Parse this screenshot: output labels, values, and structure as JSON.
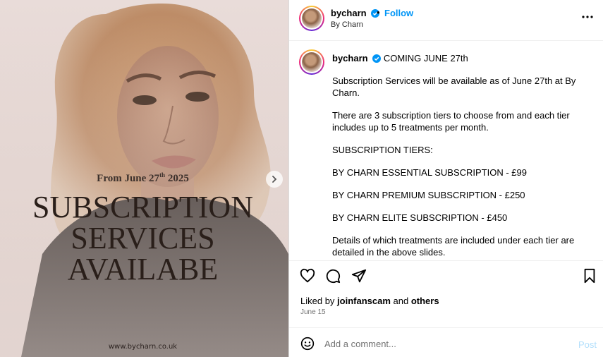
{
  "media": {
    "date_prefix": "From June 27",
    "date_sup": "th",
    "date_suffix": "2025",
    "headline": [
      "SUBSCRIPTION",
      "SERVICES",
      "AVAILABE"
    ],
    "website": "www.bycharn.co.uk"
  },
  "header": {
    "username": "bycharn",
    "separator": "•",
    "follow_label": "Follow",
    "subtitle": "By Charn",
    "more_icon": "more-horizontal-icon"
  },
  "caption": {
    "username": "bycharn",
    "headline": "COMING JUNE 27th",
    "paragraphs": [
      "Subscription Services will be available as of June 27th at By Charn.",
      "There are 3 subscription tiers to choose from and each tier includes up to 5 treatments per month.",
      "SUBSCRIPTION TIERS:",
      "BY CHARN ESSENTIAL SUBSCRIPTION - £99",
      "BY CHARN PREMIUM SUBSCRIPTION - £250",
      "BY CHARN ELITE SUBSCRIPTION - £450",
      "Details of which treatments are included under each tier are detailed in the above slides."
    ]
  },
  "engagement": {
    "liked_prefix": "Liked by ",
    "liked_user": "joinfanscam",
    "liked_mid": " and ",
    "liked_others": "others",
    "date": "June 15"
  },
  "comment": {
    "placeholder": "Add a comment...",
    "post_label": "Post"
  },
  "colors": {
    "accent": "#0095f6",
    "post_disabled": "#b2dffc",
    "verified": "#0095f6"
  }
}
